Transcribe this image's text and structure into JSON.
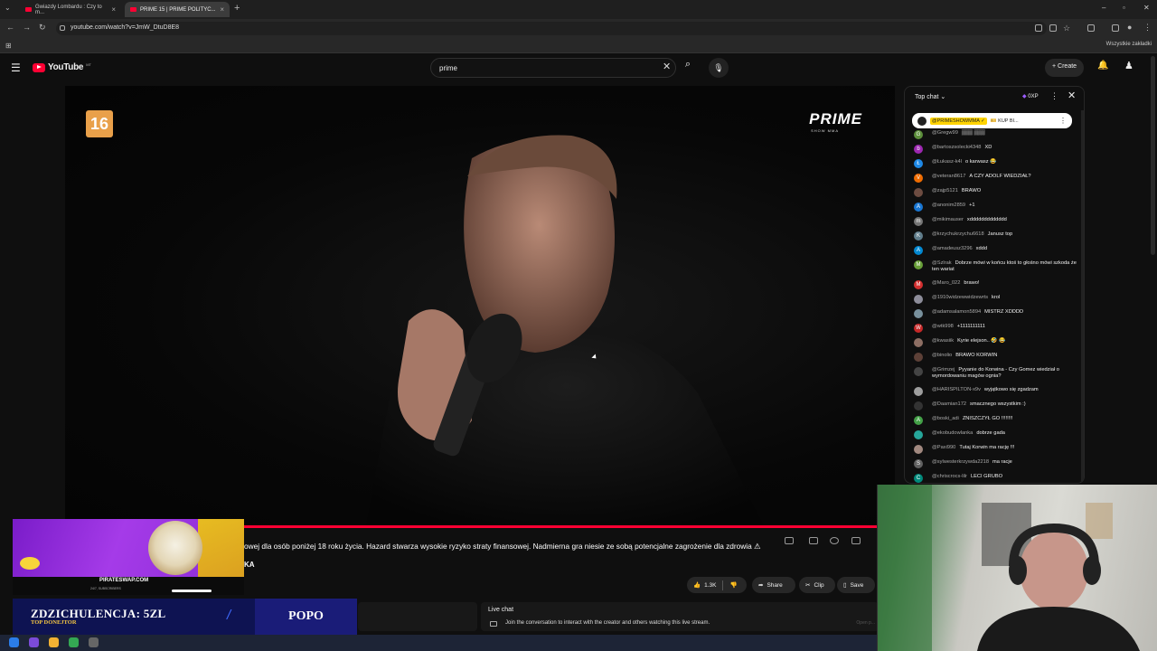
{
  "browser": {
    "tabs": [
      {
        "title": "Gwiazdy Lombardu : Czy to m..."
      },
      {
        "title": "PRIME 15 | PRIME POLITYC..."
      }
    ],
    "url": "youtube.com/watch?v=JmW_DtuD8E8",
    "bookmarks_all": "Wszystkie zakładki"
  },
  "youtube": {
    "logo_text": "YouTube",
    "country_code": "MT",
    "search_value": "prime",
    "create_label": "Create"
  },
  "video": {
    "age_badge": "16",
    "brand": "PRIME",
    "brand_sub": "SHOW MMA",
    "disclaimer": "owej dla osób poniżej 18 roku życia. Hazard stwarza wysokie ryzyko straty finansowej. Nadmierna gra niesie ze sobą potencjalne zagrożenie dla zdrowia ⚠",
    "disclaimer_line2": "KA"
  },
  "actions": {
    "likes": "1.3K",
    "share": "Share",
    "clip": "Clip",
    "save": "Save"
  },
  "chat": {
    "mode": "Top chat",
    "xp": "0XP",
    "pinned_author": "@PRIMESHOWMMA ✓",
    "pinned_text": "🎫 KUP BI...",
    "messages": [
      {
        "author": "@Gregw99",
        "text": "▒▒▒ ▒▒▒",
        "initial": "G",
        "color": "#5c8e3b"
      },
      {
        "author": "@bartoszsolecki4348",
        "text": "XD",
        "initial": "b",
        "color": "#9c27b0"
      },
      {
        "author": "@Łukasz-k4l",
        "text": "o karwasz 😂",
        "initial": "Ł",
        "color": "#1e88e5"
      },
      {
        "author": "@veteran8617",
        "text": "A CZY ADOLF WIEDZIAŁ?",
        "initial": "V",
        "color": "#ef6c00"
      },
      {
        "author": "@zajp5121",
        "text": "BRAWO",
        "initial": "",
        "color": "#6d4c41"
      },
      {
        "author": "@anonim2859",
        "text": "+1",
        "initial": "A",
        "color": "#1976d2"
      },
      {
        "author": "@mikimauser",
        "text": "xddddddddddddd",
        "initial": "m",
        "color": "#757575"
      },
      {
        "author": "@krzychukrzychu6618",
        "text": "Janusz top",
        "initial": "K",
        "color": "#607d8b"
      },
      {
        "author": "@amadeusz3296",
        "text": "xddd",
        "initial": "A",
        "color": "#0288d1"
      },
      {
        "author": "@Szlrak",
        "text": "Dobrze mówi w końcu ktoś to głośno mówi szkoda że ten wariat",
        "initial": "M",
        "color": "#689f38"
      },
      {
        "author": "@Maro_022",
        "text": "brawo!",
        "initial": "M",
        "color": "#d32f2f"
      },
      {
        "author": "@1910widzewwidzewrts",
        "text": "krol",
        "initial": "",
        "color": "#8d8d9a"
      },
      {
        "author": "@adamsalamon5894",
        "text": "MISTRZ XDDDD",
        "initial": "",
        "color": "#78909c"
      },
      {
        "author": "@wtk998",
        "text": "+1111111111",
        "initial": "W",
        "color": "#c62828"
      },
      {
        "author": "@kwasiik",
        "text": "Kyrie elejson.. 🤣 😂",
        "initial": "",
        "color": "#8d6e63"
      },
      {
        "author": "@binolio",
        "text": "BRAWO KORWIN",
        "initial": "",
        "color": "#5d4037"
      },
      {
        "author": "@Grimzej",
        "text": "Pyyanie do Korwina - Czy Gomez wiedział o wymordowaniu magów ognia?",
        "initial": "",
        "color": "#444444"
      },
      {
        "author": "@HARISPILTON-x9v",
        "text": "wyjątkowo się zgadzam",
        "initial": "",
        "color": "#9e9e9e"
      },
      {
        "author": "@Daamian172",
        "text": "smacznego wszystkim :)",
        "initial": "",
        "color": "#333333"
      },
      {
        "author": "@boski_adi",
        "text": "ZNISZCZYŁ GO !!!!!!!!",
        "initial": "A",
        "color": "#43a047"
      },
      {
        "author": "@ekobudowlanka",
        "text": "dobrze gada",
        "initial": "",
        "color": "#26a69a"
      },
      {
        "author": "@Paxi990",
        "text": "Tutaj Korwin ma rację !!!",
        "initial": "",
        "color": "#a1887f"
      },
      {
        "author": "@sylwesterkrzywda2218",
        "text": "ma racje",
        "initial": "S",
        "color": "#616161"
      },
      {
        "author": "@chriscrocs-lilr",
        "text": "LECI GRUBO",
        "initial": "C",
        "color": "#00897b"
      }
    ]
  },
  "live_chat": {
    "title": "Live chat",
    "prompt": "Join the conversation to interact with the creator and others watching this live stream.",
    "open": "Open p..."
  },
  "overlay": {
    "ad_url": "PIRATESWAP.COM",
    "ad_sub": "24/7, SUBSCRIBERS",
    "donation_label": "ZDZICHULENCJA: 5ZL",
    "donation_sub": "TOP DONEJTOR",
    "donation_name": "POPO"
  }
}
